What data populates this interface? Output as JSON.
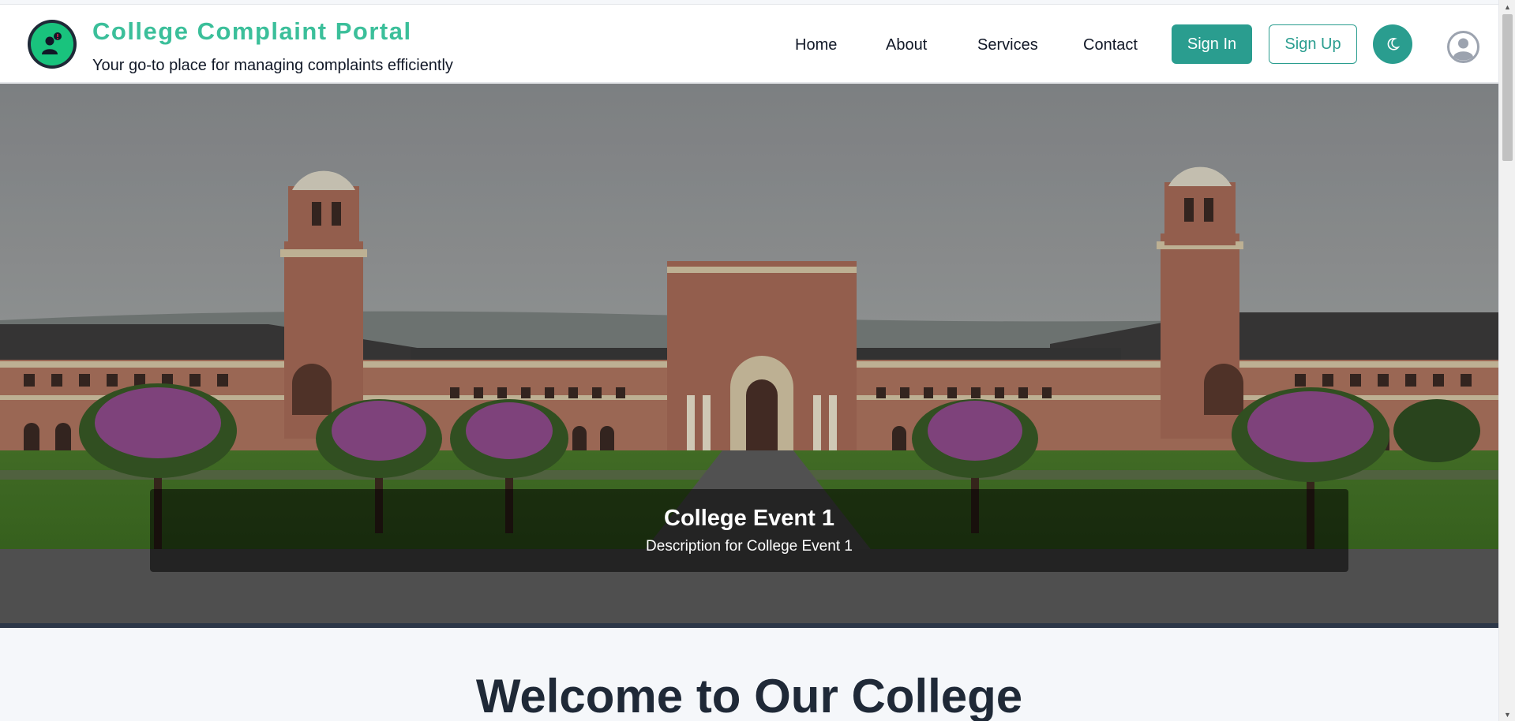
{
  "header": {
    "brand_title": "College Complaint Portal",
    "brand_subtitle": "Your go-to place for managing complaints efficiently",
    "nav": [
      {
        "label": "Home"
      },
      {
        "label": "About"
      },
      {
        "label": "Services"
      },
      {
        "label": "Contact"
      }
    ],
    "signin_label": "Sign In",
    "signup_label": "Sign Up",
    "theme_icon": "moon-icon",
    "avatar_icon": "user-avatar-icon",
    "logo_icon": "complaint-user-icon"
  },
  "hero": {
    "slide_title": "College Event 1",
    "slide_description": "Description for College Event 1"
  },
  "main": {
    "welcome_heading": "Welcome to Our College"
  },
  "colors": {
    "brand_teal": "#2a9d8f",
    "brand_title": "#3bbf9a",
    "logo_green": "#19c37d"
  }
}
